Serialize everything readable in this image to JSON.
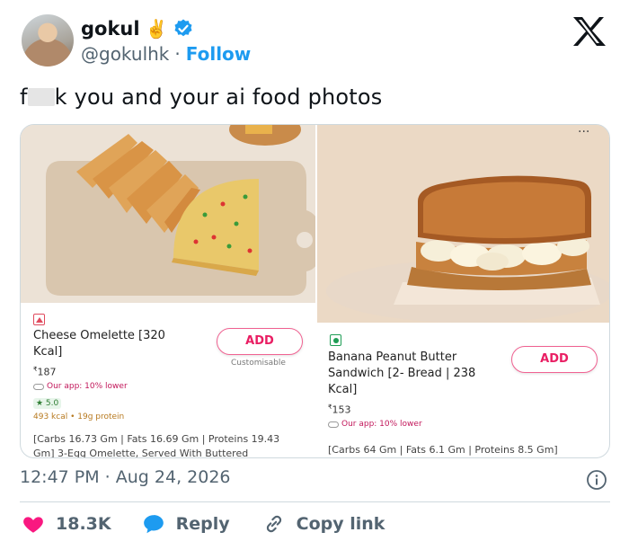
{
  "user": {
    "name": "gokul",
    "emoji": "✌️",
    "handle": "@gokulhk",
    "separator": "·",
    "follow_label": "Follow"
  },
  "tweet": {
    "text_start": "f",
    "text_end": "k you and your ai food photos"
  },
  "left_item": {
    "title": "Cheese Omelette [320 Kcal]",
    "price_symbol": "₹",
    "price": "187",
    "offer": "Our app: 10% lower",
    "rating": "★ 5.0",
    "kcal": "493 kcal • 19g protein",
    "add_label": "ADD",
    "customisable": "Customisable",
    "macros_line1": "[Carbs 16.73 Gm | Fats 16.69 Gm | Proteins 19.43",
    "macros_line2": "Gm] 3-Egg Omelette, Served With Buttered"
  },
  "right_item": {
    "title": "Banana Peanut Butter Sandwich [2- Bread | 238 Kcal]",
    "price_symbol": "₹",
    "price": "153",
    "offer": "Our app: 10% lower",
    "add_label": "ADD",
    "macros": "[Carbs 64 Gm | Fats 6.1 Gm | Proteins 8.5 Gm]"
  },
  "more_dots": "···",
  "timestamp": "12:47 PM · Aug 24, 2026",
  "actions": {
    "likes": "18.3K",
    "reply": "Reply",
    "copy_link": "Copy link"
  },
  "colors": {
    "follow": "#1d9bf0",
    "like": "#f91880",
    "reply": "#1d9bf0",
    "add_button": "#e91e63"
  }
}
